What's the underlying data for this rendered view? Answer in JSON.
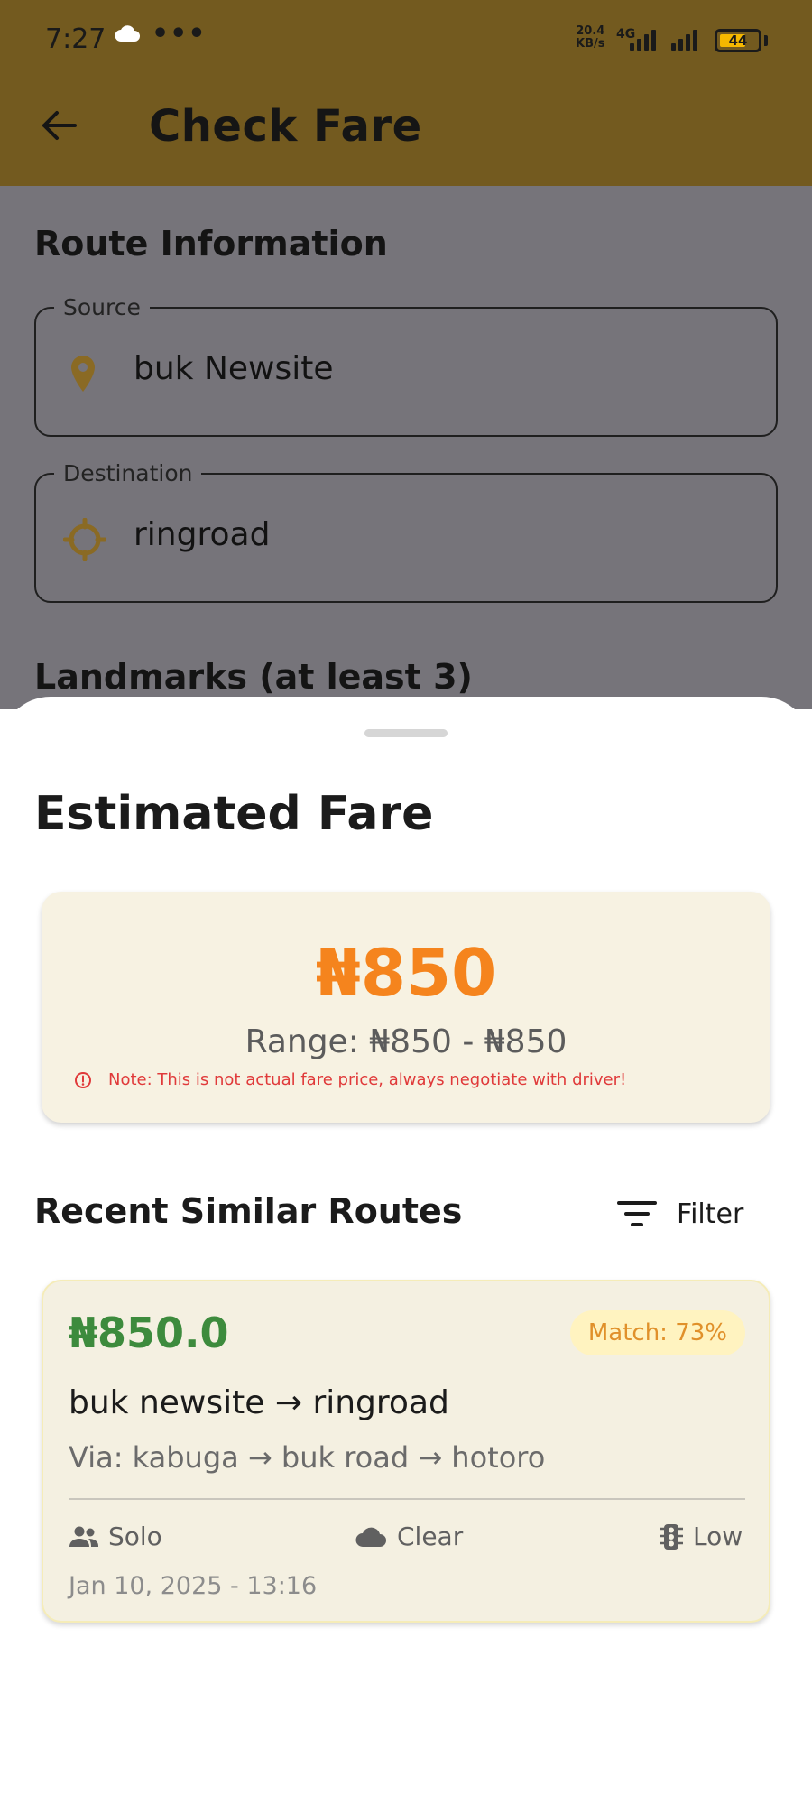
{
  "status_bar": {
    "time": "7:27",
    "more": "•••",
    "speed_value": "20.4",
    "speed_unit": "KB/s",
    "network": "4G",
    "battery": "44"
  },
  "app_bar": {
    "title": "Check Fare"
  },
  "form": {
    "section_route": "Route Information",
    "source_label": "Source",
    "source_value": "buk Newsite",
    "destination_label": "Destination",
    "destination_value": "ringroad",
    "section_landmarks": "Landmarks (at least 3)"
  },
  "sheet": {
    "title": "Estimated Fare",
    "fare": {
      "amount": "₦850",
      "range": "Range: ₦850 - ₦850",
      "note": "Note: This is not actual fare price, always negotiate with driver!"
    },
    "recent_title": "Recent Similar Routes",
    "filter_label": "Filter",
    "routes": [
      {
        "price": "₦850.0",
        "match": "Match: 73%",
        "path": "buk newsite → ringroad",
        "via": "Via: kabuga → buk road → hotoro",
        "passengers": "Solo",
        "weather": "Clear",
        "traffic": "Low",
        "date": "Jan 10, 2025 - 13:16"
      }
    ]
  },
  "colors": {
    "accent": "#735a1f",
    "fare_orange": "#f5841d",
    "price_green": "#3d8b3d",
    "note_red": "#e03a3a"
  }
}
